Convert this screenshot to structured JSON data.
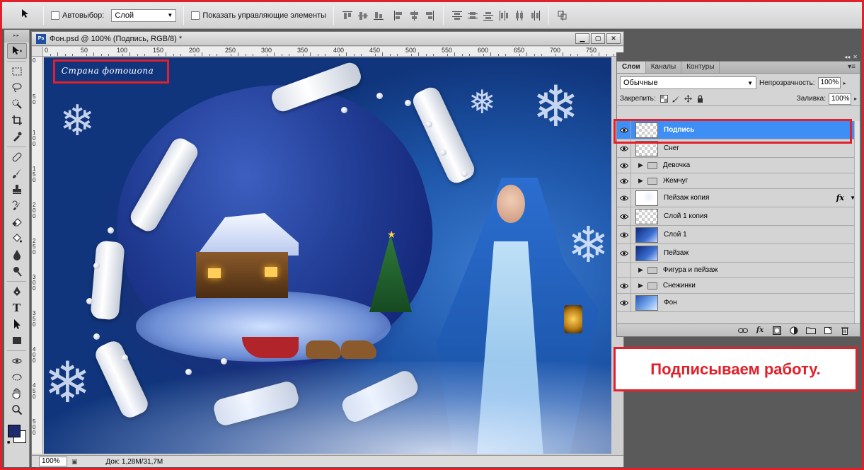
{
  "options_bar": {
    "auto_select_label": "Автовыбор:",
    "auto_select_value": "Слой",
    "show_controls_label": "Показать управляющие элементы"
  },
  "document": {
    "title": "Фон.psd @ 100% (Подпись, RGB/8) *",
    "ps_badge": "Ps",
    "ruler_top": [
      "0",
      "50",
      "100",
      "150",
      "200",
      "250",
      "300",
      "350",
      "400",
      "450",
      "500",
      "550",
      "600",
      "650",
      "700",
      "750"
    ],
    "ruler_left": [
      "0",
      "5\n0",
      "1\n0\n0",
      "1\n5\n0",
      "2\n0\n0",
      "2\n5\n0",
      "3\n0\n0",
      "3\n5\n0",
      "4\n0\n0",
      "4\n5\n0",
      "5\n0\n0",
      "5\n5\n0"
    ],
    "signature_text": "Страна фотошопа",
    "zoom": "100%",
    "doc_size": "Док: 1,28M/31,7M"
  },
  "layers_panel": {
    "tabs": [
      "Слои",
      "Каналы",
      "Контуры"
    ],
    "blend_mode": "Обычные",
    "opacity_label": "Непрозрачность:",
    "opacity_value": "100%",
    "lock_label": "Закрепить:",
    "fill_label": "Заливка:",
    "fill_value": "100%",
    "layers": [
      {
        "name": "Подпись",
        "kind": "layer",
        "visible": true,
        "selected": true,
        "thumb": "transparent"
      },
      {
        "name": "Снег",
        "kind": "layer",
        "visible": true,
        "thumb": "transparent"
      },
      {
        "name": "Девочка",
        "kind": "group",
        "visible": true
      },
      {
        "name": "Жемчуг",
        "kind": "group",
        "visible": true
      },
      {
        "name": "Пейзаж копия",
        "kind": "layer",
        "visible": true,
        "thumb": "scrap",
        "fx": "fx"
      },
      {
        "name": "Слой 1 копия",
        "kind": "layer",
        "visible": true,
        "thumb": "transparent"
      },
      {
        "name": "Слой 1",
        "kind": "layer",
        "visible": true,
        "thumb": "art"
      },
      {
        "name": "Пейзаж",
        "kind": "layer",
        "visible": true,
        "thumb": "art"
      },
      {
        "name": "Фигура и пейзаж",
        "kind": "group",
        "visible": false
      },
      {
        "name": "Снежинки",
        "kind": "group",
        "visible": true
      },
      {
        "name": "Фон",
        "kind": "layer",
        "visible": true,
        "thumb": "fon"
      }
    ],
    "footer_fx": "fx"
  },
  "callout": {
    "text": "Подписываем работу."
  },
  "colors": {
    "accent_red": "#e3202a",
    "selection_blue": "#3d8ef5",
    "foreground_color": "#1c2b6e"
  }
}
